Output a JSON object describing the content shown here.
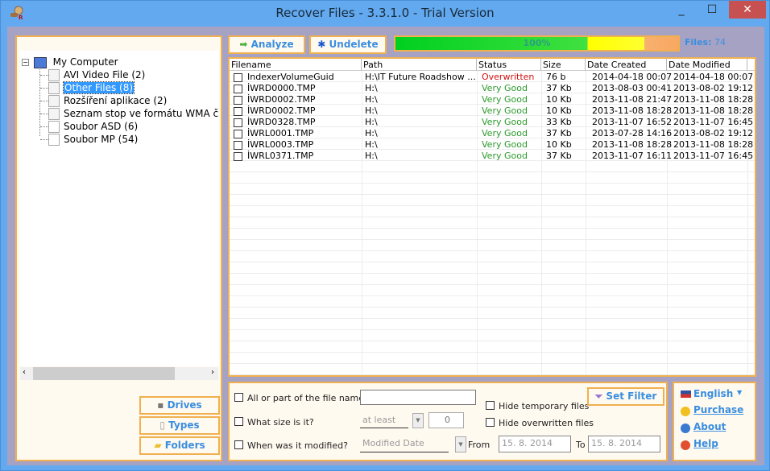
{
  "window": {
    "title": "Recover Files - 3.3.1.0 - Trial Version",
    "minimize": "_",
    "maximize": "☐",
    "close": "✕"
  },
  "tree": {
    "root": "My Computer",
    "items": [
      {
        "label": "AVI Video File (2)",
        "icon": "video-file-icon"
      },
      {
        "label": "Other Files (8)",
        "icon": "other-file-icon",
        "selected": true
      },
      {
        "label": "Rozšíření aplikace (2)",
        "icon": "app-extension-icon"
      },
      {
        "label": "Seznam stop ve formátu WMA či WMV",
        "icon": "playlist-icon"
      },
      {
        "label": "Soubor ASD (6)",
        "icon": "file-icon"
      },
      {
        "label": "Soubor MP (54)",
        "icon": "file-icon"
      }
    ]
  },
  "nav": {
    "drives": "Drives",
    "types": "Types",
    "folders": "Folders"
  },
  "toolbar": {
    "analyze": "Analyze",
    "undelete": "Undelete",
    "progress_text": "100%",
    "progress": 100,
    "files_label": "Files:",
    "files_count": "74"
  },
  "table": {
    "columns": [
      "Filename",
      "Path",
      "Status",
      "Size",
      "Date Created",
      "Date Modified"
    ],
    "rows": [
      {
        "name": "IndexerVolumeGuid",
        "path": "H:\\IT Future Roadshow ...",
        "status": "Overwritten",
        "size": "76 b",
        "created": "2014-04-18 00:07",
        "modified": "2014-04-18 00:07"
      },
      {
        "name": "İWRD0000.TMP",
        "path": "H:\\",
        "status": "Very Good",
        "size": "37 Kb",
        "created": "2013-08-03 00:41",
        "modified": "2013-08-02 19:12"
      },
      {
        "name": "İWRD0002.TMP",
        "path": "H:\\",
        "status": "Very Good",
        "size": "10 Kb",
        "created": "2013-11-08 21:47",
        "modified": "2013-11-08 18:28"
      },
      {
        "name": "İWRD0002.TMP",
        "path": "H:\\",
        "status": "Very Good",
        "size": "10 Kb",
        "created": "2013-11-08 18:28",
        "modified": "2013-11-08 18:28"
      },
      {
        "name": "İWRD0328.TMP",
        "path": "H:\\",
        "status": "Very Good",
        "size": "33 Kb",
        "created": "2013-11-07 16:52",
        "modified": "2013-11-07 16:45"
      },
      {
        "name": "İWRL0001.TMP",
        "path": "H:\\",
        "status": "Very Good",
        "size": "37 Kb",
        "created": "2013-07-28 14:16",
        "modified": "2013-08-02 19:12"
      },
      {
        "name": "İWRL0003.TMP",
        "path": "H:\\",
        "status": "Very Good",
        "size": "10 Kb",
        "created": "2013-11-08 18:28",
        "modified": "2013-11-08 18:28"
      },
      {
        "name": "İWRL0371.TMP",
        "path": "H:\\",
        "status": "Very Good",
        "size": "37 Kb",
        "created": "2013-11-07 16:11",
        "modified": "2013-11-07 16:45"
      }
    ]
  },
  "filter": {
    "name_label": "All or part of the file name:",
    "name_value": "",
    "size_label": "What size is it?",
    "size_mode": "at least",
    "size_value": "0",
    "modified_label": "When was it modified?",
    "date_type": "Modified Date",
    "from_label": "From",
    "from_value": "15. 8. 2014",
    "to_label": "To",
    "to_value": "15. 8. 2014",
    "hide_temp": "Hide temporary files",
    "hide_overwritten": "Hide overwritten files",
    "set_filter": "Set Filter"
  },
  "links": {
    "language": "English",
    "purchase": "Purchase",
    "about": "About",
    "help": "Help"
  },
  "colors": {
    "accent": "#3a8ee0",
    "panel_border": "#f0b050",
    "good": "#2a9a2a",
    "bad": "#d01010"
  }
}
